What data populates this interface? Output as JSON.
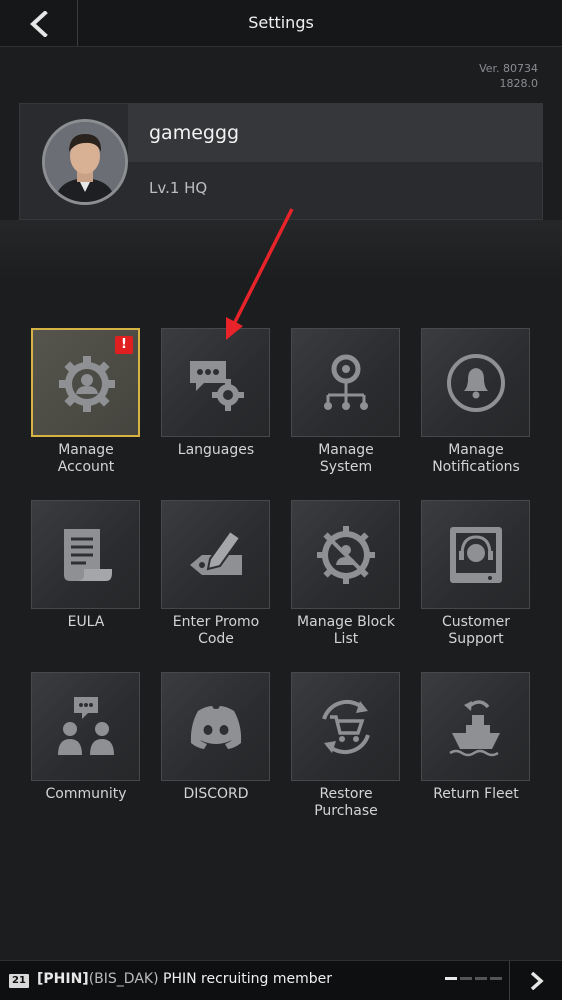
{
  "header": {
    "title": "Settings",
    "back_icon": "chevron-left-icon"
  },
  "version": {
    "line1": "Ver. 80734",
    "line2": "1828.0"
  },
  "profile": {
    "username": "gameggg",
    "level": "Lv.1 HQ"
  },
  "menu": {
    "items": [
      {
        "label": "Manage\nAccount",
        "icon": "user-gear-icon",
        "selected": true,
        "alert": "!"
      },
      {
        "label": "Languages",
        "icon": "chat-gear-icon"
      },
      {
        "label": "Manage\nSystem",
        "icon": "system-node-icon"
      },
      {
        "label": "Manage\nNotifications",
        "icon": "bell-icon"
      },
      {
        "label": "EULA",
        "icon": "document-icon"
      },
      {
        "label": "Enter Promo\nCode",
        "icon": "pen-tag-icon"
      },
      {
        "label": "Manage Block\nList",
        "icon": "block-user-icon"
      },
      {
        "label": "Customer\nSupport",
        "icon": "headset-icon"
      },
      {
        "label": "Community",
        "icon": "community-icon"
      },
      {
        "label": "DISCORD",
        "icon": "discord-icon"
      },
      {
        "label": "Restore\nPurchase",
        "icon": "cart-refresh-icon"
      },
      {
        "label": "Return Fleet",
        "icon": "ship-return-icon"
      }
    ]
  },
  "chat": {
    "badge": "21",
    "tag1": "[PHIN]",
    "tag2": "(BIS_DAK)",
    "message": "PHIN recruiting member",
    "next_icon": "chevron-right-icon"
  },
  "colors": {
    "background": "#1c1d1f",
    "selected_border": "#d7b244",
    "alert": "#e02020",
    "annotation_arrow": "#e8232a"
  }
}
